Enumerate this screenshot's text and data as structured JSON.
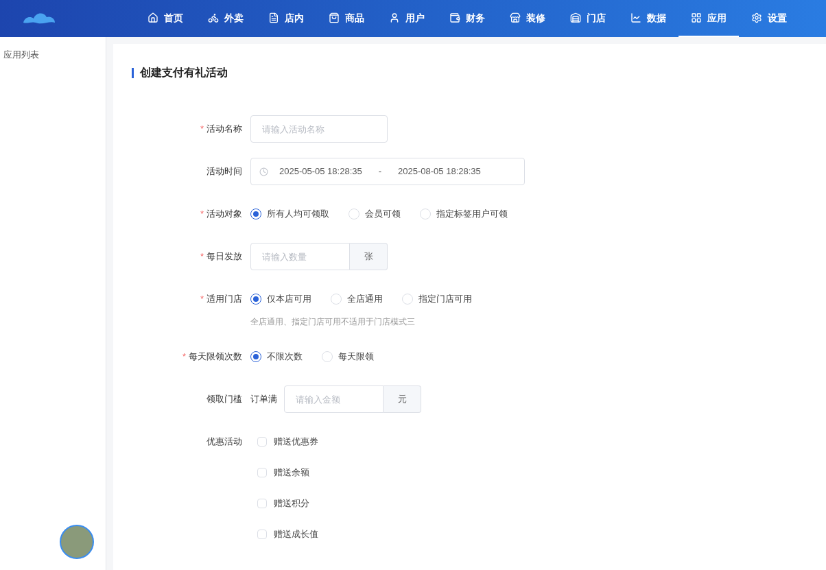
{
  "nav": [
    {
      "label": "首页",
      "selected": false
    },
    {
      "label": "外卖",
      "selected": false
    },
    {
      "label": "店内",
      "selected": false
    },
    {
      "label": "商品",
      "selected": false
    },
    {
      "label": "用户",
      "selected": false
    },
    {
      "label": "财务",
      "selected": false
    },
    {
      "label": "装修",
      "selected": false
    },
    {
      "label": "门店",
      "selected": false
    },
    {
      "label": "数据",
      "selected": false
    },
    {
      "label": "应用",
      "selected": true
    },
    {
      "label": "设置",
      "selected": false
    }
  ],
  "sidebar": {
    "items": [
      {
        "label": "应用列表",
        "selected": false
      }
    ]
  },
  "form": {
    "title": "创建支付有礼活动",
    "fields": [
      {
        "kind": "input",
        "label": "活动名称",
        "required_mark": "*",
        "placeholder": "请输入活动名称"
      },
      {
        "kind": "date_range",
        "label": "活动时间",
        "start": "2025-05-05 18:28:35",
        "separator": "-",
        "end": "2025-08-05 18:28:35"
      },
      {
        "kind": "radio",
        "label": "活动对象",
        "required_mark": "*",
        "options": [
          {
            "label": "所有人均可领取",
            "selected": true
          },
          {
            "label": "会员可领",
            "selected": false
          },
          {
            "label": "指定标签用户可领",
            "selected": false
          }
        ]
      },
      {
        "kind": "addon_input",
        "label": "每日发放",
        "required_mark": "*",
        "placeholder": "请输入数量",
        "suffix": "张"
      },
      {
        "kind": "radio",
        "label": "适用门店",
        "required_mark": "*",
        "hint": "全店通用、指定门店可用不适用于门店模式三",
        "options": [
          {
            "label": "仅本店可用",
            "selected": true
          },
          {
            "label": "全店通用",
            "selected": false
          },
          {
            "label": "指定门店可用",
            "selected": false
          }
        ]
      },
      {
        "kind": "radio",
        "label": "每天限领次数",
        "required_mark": "*",
        "options": [
          {
            "label": "不限次数",
            "selected": true
          },
          {
            "label": "每天限领",
            "selected": false
          }
        ]
      },
      {
        "kind": "addon_input",
        "label": "领取门槛",
        "prefix": "订单满",
        "placeholder": "请输入金额",
        "suffix": "元"
      },
      {
        "kind": "checkboxes",
        "label": "优惠活动",
        "options": [
          {
            "label": "赠送优惠券",
            "checked": false
          },
          {
            "label": "赠送余额",
            "checked": false
          },
          {
            "label": "赠送积分",
            "checked": false
          },
          {
            "label": "赠送成长值",
            "checked": false
          }
        ]
      }
    ]
  }
}
